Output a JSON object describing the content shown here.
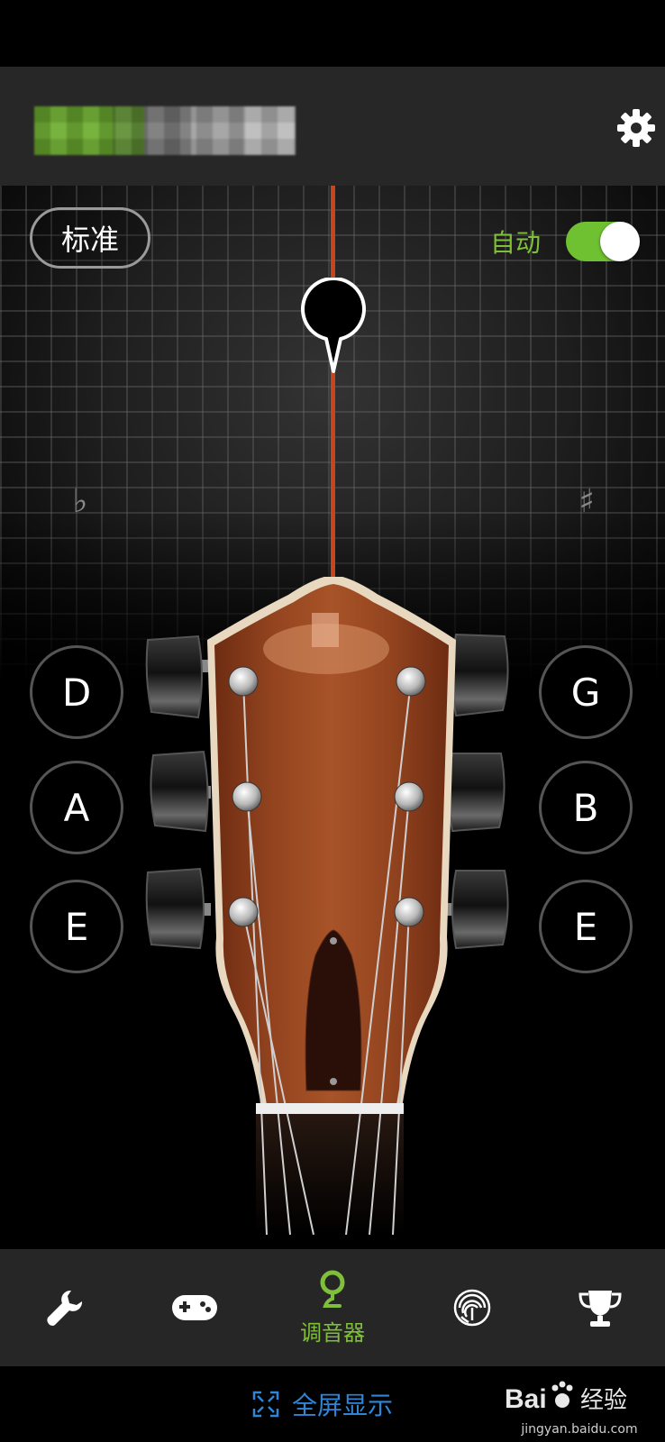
{
  "tuning": {
    "mode_label": "标准",
    "auto_label": "自动",
    "auto_enabled": true
  },
  "pitch": {
    "flat_symbol": "♭",
    "sharp_symbol": "♯"
  },
  "strings": {
    "left": [
      "D",
      "A",
      "E"
    ],
    "right": [
      "G",
      "B",
      "E"
    ]
  },
  "nav": {
    "active_label": "调音器"
  },
  "footer": {
    "fullscreen_label": "全屏显示"
  },
  "watermark": {
    "brand": "Bai",
    "brand_suffix": "经验",
    "domain": "jingyan.baidu.com"
  },
  "colors": {
    "accent": "#7fbf3a",
    "needle": "#c8441a",
    "link": "#2f86d6"
  },
  "icons": [
    "gear-icon",
    "wrench-icon",
    "gamepad-icon",
    "tuner-pin-icon",
    "fingerprint-icon",
    "trophy-icon",
    "fullscreen-icon",
    "paw-icon"
  ]
}
